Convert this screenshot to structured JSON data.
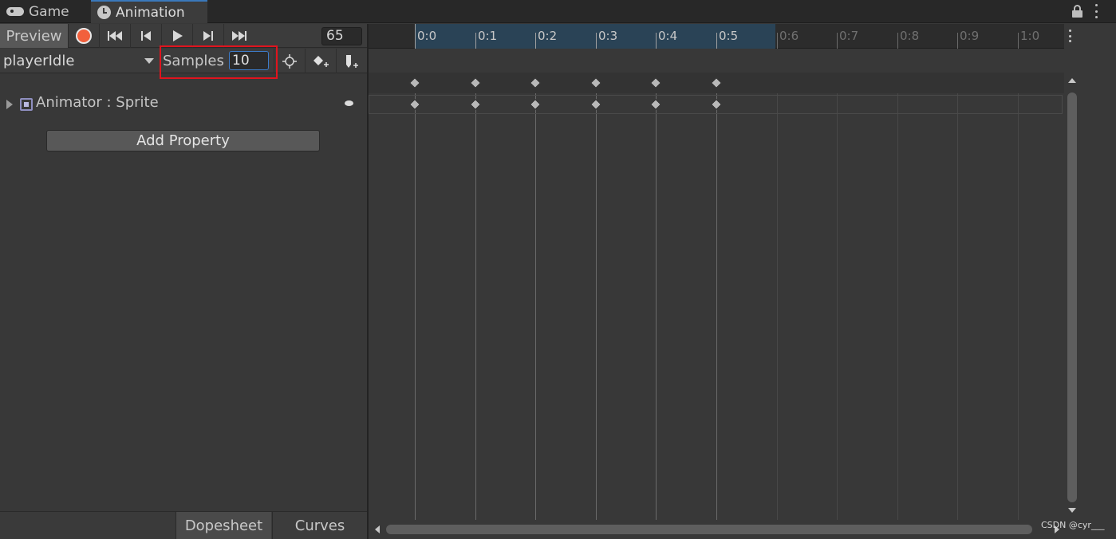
{
  "tabs": [
    {
      "label": "Game",
      "icon": "gamepad-icon",
      "active": false
    },
    {
      "label": "Animation",
      "icon": "clock-icon",
      "active": true
    }
  ],
  "toolbar": {
    "preview_label": "Preview",
    "frame_value": "65",
    "record_color": "#f2603c"
  },
  "clip": {
    "name": "playerIdle",
    "samples_label": "Samples",
    "samples_value": "10",
    "highlight_color": "#e0141e"
  },
  "properties": [
    {
      "label": "Animator : Sprite",
      "icon": "sprite-icon"
    }
  ],
  "add_property_label": "Add Property",
  "bottom_tabs": {
    "dopesheet": "Dopesheet",
    "curves": "Curves"
  },
  "timeline": {
    "ticks": [
      "0:0",
      "0:1",
      "0:2",
      "0:3",
      "0:4",
      "0:5",
      "0:6",
      "0:7",
      "0:8",
      "0:9",
      "1:0"
    ],
    "active_tick_count": 6,
    "keyframes": [
      0,
      1,
      2,
      3,
      4,
      5
    ],
    "active_color": "#2a4356"
  },
  "watermark": "CSDN @cyr___"
}
